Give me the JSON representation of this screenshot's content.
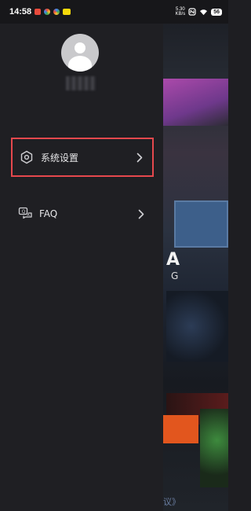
{
  "status_bar": {
    "time": "14:58",
    "net_speed_top": "5.30",
    "net_speed_bottom": "KB/s",
    "battery": "56"
  },
  "drawer": {
    "menu": [
      {
        "label": "系统设置",
        "icon": "hexagon-settings-icon"
      },
      {
        "label": "FAQ",
        "icon": "faq-chat-icon"
      }
    ]
  },
  "background_app": {
    "logo_letter_a": "A",
    "logo_letter_g": "G",
    "footer_text": "议》"
  },
  "colors": {
    "drawer_bg": "#1f1f23",
    "highlight_border": "#e5484d",
    "accent_orange": "#e2561e"
  }
}
